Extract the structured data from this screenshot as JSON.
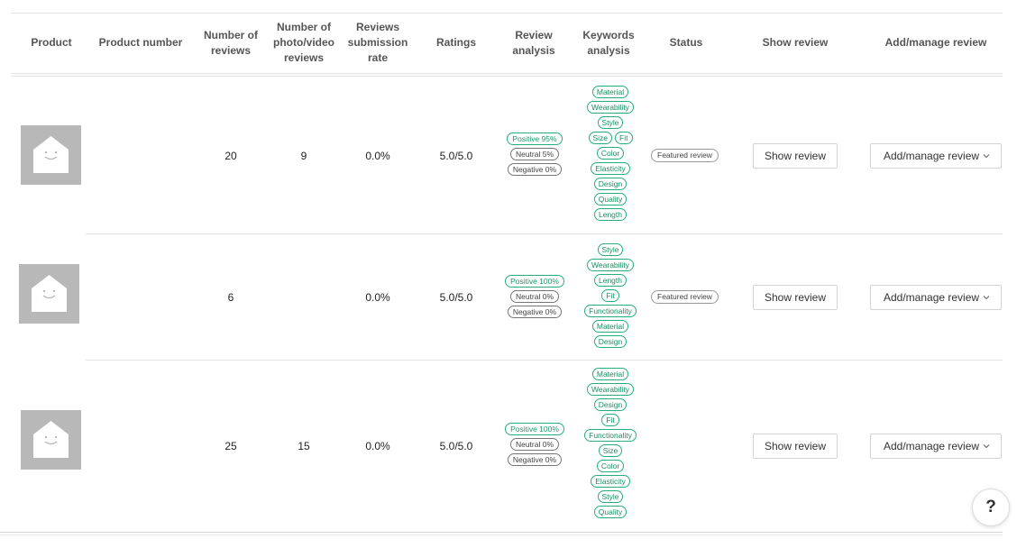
{
  "table": {
    "headers": {
      "product": "Product",
      "product_number": "Product number",
      "num_reviews": "Number of reviews",
      "num_photo_video": "Number of photo/video reviews",
      "submission_rate": "Reviews submission rate",
      "ratings": "Ratings",
      "review_analysis": "Review analysis",
      "keywords_analysis": "Keywords analysis",
      "status": "Status",
      "show_review": "Show review",
      "add_manage": "Add/manage review"
    },
    "rows": [
      {
        "product_number": "",
        "num_reviews": "20",
        "num_photo_video": "9",
        "submission_rate": "0.0%",
        "ratings": "5.0/5.0",
        "review_analysis": {
          "positive": "Positive 95%",
          "neutral": "Neutral 5%",
          "negative": "Negative 0%"
        },
        "keywords": [
          "Material",
          "Wearability",
          "Style",
          "Size",
          "Fit",
          "Color",
          "Elasticity",
          "Design",
          "Quality",
          "Length"
        ],
        "status": "Featured review",
        "show_review": "Show review",
        "add_manage": "Add/manage review"
      },
      {
        "product_number": "",
        "num_reviews": "6",
        "num_photo_video": "",
        "submission_rate": "0.0%",
        "ratings": "5.0/5.0",
        "review_analysis": {
          "positive": "Positive 100%",
          "neutral": "Neutral 0%",
          "negative": "Negative 0%"
        },
        "keywords": [
          "Style",
          "Wearability",
          "Length",
          "Fit",
          "Functionality",
          "Material",
          "Design"
        ],
        "status": "Featured review",
        "show_review": "Show review",
        "add_manage": "Add/manage review"
      },
      {
        "product_number": "",
        "num_reviews": "25",
        "num_photo_video": "15",
        "submission_rate": "0.0%",
        "ratings": "5.0/5.0",
        "review_analysis": {
          "positive": "Positive 100%",
          "neutral": "Neutral 0%",
          "negative": "Negative 0%"
        },
        "keywords": [
          "Material",
          "Wearability",
          "Design",
          "Fit",
          "Functionality",
          "Size",
          "Color",
          "Elasticity",
          "Style",
          "Quality"
        ],
        "status": "",
        "show_review": "Show review",
        "add_manage": "Add/manage review"
      }
    ]
  },
  "icons": {
    "placeholder_thumbnail": "product-placeholder-icon",
    "dropdown": "chevron-down-icon",
    "help": "help-icon"
  },
  "help_label": "?",
  "colors": {
    "accent": "#25b07b",
    "divider": "#e4e4e4",
    "thumbnail": "#b8b8b8"
  }
}
